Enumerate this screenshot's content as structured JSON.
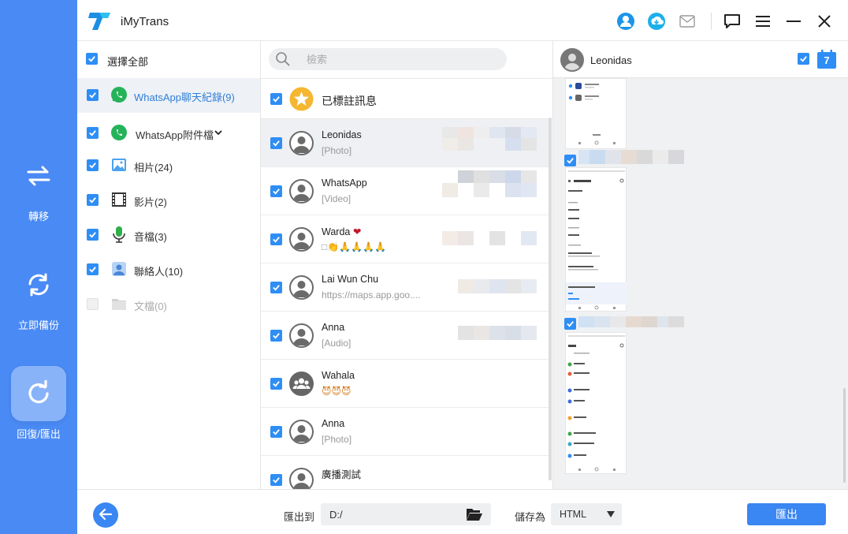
{
  "app": {
    "title": "iMyTrans"
  },
  "nav": {
    "transfer": "轉移",
    "backup": "立即備份",
    "restore": "回復/匯出"
  },
  "categories": {
    "select_all": "選擇全部",
    "items": [
      {
        "label": "WhatsApp聊天紀錄(9)",
        "checked": true,
        "selected": true
      },
      {
        "label": "WhatsApp附件檔",
        "checked": true
      },
      {
        "label": "相片(24)",
        "checked": true
      },
      {
        "label": "影片(2)",
        "checked": true
      },
      {
        "label": "音檔(3)",
        "checked": true
      },
      {
        "label": "聯絡人(10)",
        "checked": true
      },
      {
        "label": "文檔(0)",
        "checked": false
      }
    ]
  },
  "chats": {
    "search_placeholder": "檢索",
    "starred": "已標註訊息",
    "items": [
      {
        "name": "Leonidas",
        "sub": "[Photo]",
        "selected": true
      },
      {
        "name": "WhatsApp",
        "sub": "[Video]"
      },
      {
        "name": "Warda",
        "name_emoji": "❤",
        "sub": "□👏🙏🙏🙏🙏"
      },
      {
        "name": "Lai Wun Chu",
        "sub": "https://maps.app.goo...."
      },
      {
        "name": "Anna",
        "sub": "[Audio]"
      },
      {
        "name": "Wahala",
        "sub": "😈😈😈",
        "group": true
      },
      {
        "name": "Anna",
        "sub": "[Photo]"
      },
      {
        "name": "廣播測試",
        "sub": ""
      }
    ]
  },
  "preview": {
    "contact": "Leonidas",
    "calendar_day": "7"
  },
  "bottom": {
    "export_to_label": "匯出到",
    "path": "D:/",
    "save_as_label": "儲存為",
    "format": "HTML",
    "export_button": "匯出"
  },
  "colors": {
    "accent": "#3a86f2",
    "nav": "#4a8af4",
    "whatsapp": "#25b35a"
  }
}
